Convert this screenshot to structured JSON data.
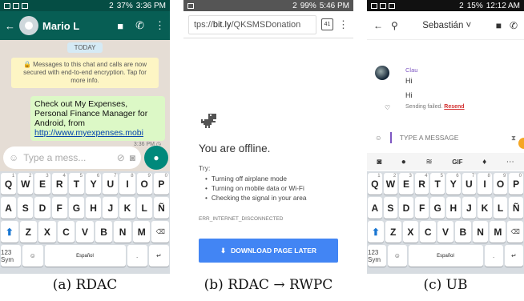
{
  "panel_a": {
    "status": {
      "time": "3:36 PM",
      "battery": "37%",
      "sim": "2"
    },
    "contact": "Mario L",
    "date_chip": "TODAY",
    "notice": "🔒 Messages to this chat and calls are now secured with end-to-end encryption. Tap for more info.",
    "message": {
      "text": "Check out My Expenses, Personal Finance Manager for Android, from",
      "link": "http://www.myexpenses.mobi",
      "time": "3:36 PM ◷"
    },
    "input_placeholder": "Type a mess...",
    "caption": "(a) RDAC"
  },
  "panel_b": {
    "status": {
      "time": "5:46 PM",
      "battery": "99%",
      "sim": "2"
    },
    "url_prefix": "tps://",
    "url_host": "bit.ly",
    "url_path": "/QKSMSDonation",
    "tab_count": "41",
    "title": "You are offline.",
    "try_label": "Try:",
    "tips": [
      "Turning off airplane mode",
      "Turning on mobile data or Wi-Fi",
      "Checking the signal in your area"
    ],
    "error_code": "ERR_INTERNET_DISCONNECTED",
    "download_label": "DOWNLOAD PAGE LATER",
    "caption": "(b) RDAC → RWPC"
  },
  "panel_c": {
    "status": {
      "time": "12:12 AM",
      "battery": "15%",
      "sim": "2"
    },
    "contact": "Sebastián",
    "sender": "Clau",
    "messages": [
      "Hi",
      "Hi"
    ],
    "failed_text": "Sending failed.",
    "resend": "Resend",
    "input_placeholder": "TYPE A MESSAGE",
    "gif_label": "GIF",
    "caption": "(c) UB"
  },
  "keyboard": {
    "row1": [
      "Q",
      "W",
      "E",
      "R",
      "T",
      "Y",
      "U",
      "I",
      "O",
      "P"
    ],
    "row1_sup": [
      "1",
      "2",
      "3",
      "4",
      "5",
      "6",
      "7",
      "8",
      "9",
      "0"
    ],
    "row2": [
      "A",
      "S",
      "D",
      "F",
      "G",
      "H",
      "J",
      "K",
      "L",
      "Ñ"
    ],
    "row3": [
      "Z",
      "X",
      "C",
      "V",
      "B",
      "N",
      "M"
    ],
    "sym_label": "123 Sym",
    "space_label": "Español",
    "colors": {
      "bg": "#d7dce1",
      "shift": "#1976d2"
    }
  },
  "colors": {
    "whatsapp": "#075e54",
    "chrome_button": "#4285f4",
    "failed": "#d32f2f"
  }
}
